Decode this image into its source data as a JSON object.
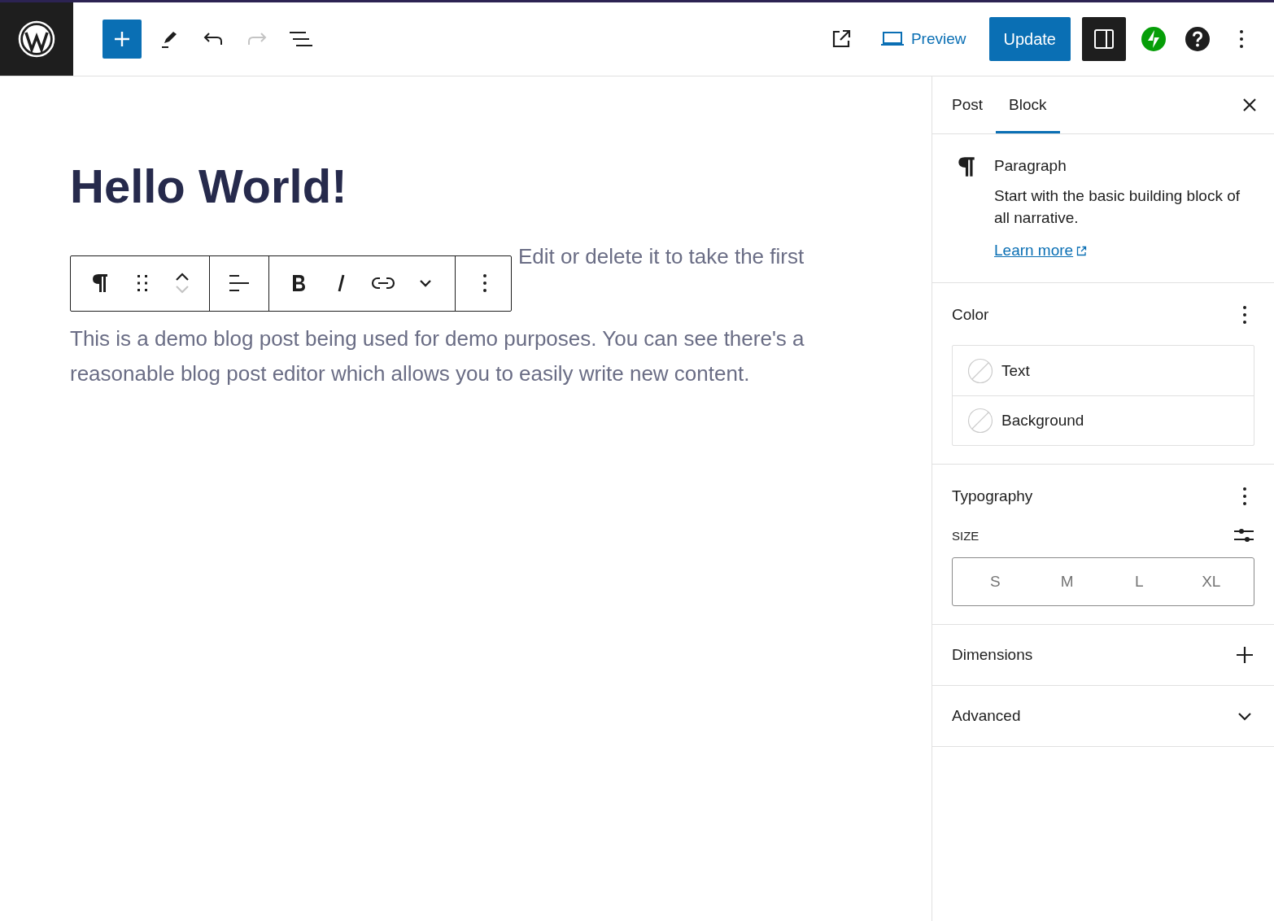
{
  "header": {
    "tools": [
      {
        "kind": "add",
        "disabled": false
      },
      {
        "kind": "edit",
        "disabled": false
      },
      {
        "kind": "undo",
        "disabled": false
      },
      {
        "kind": "redo",
        "disabled": true
      },
      {
        "kind": "outline",
        "disabled": false
      }
    ],
    "preview": "Preview",
    "update": "Update",
    "settings_on": true
  },
  "editor": {
    "title": "Hello World!",
    "paragraphs": [
      "Edit or delete it to take the first",
      "This is a demo blog post being used for demo purposes. You can see there's a reasonable blog post editor which allows you to easily write new content."
    ],
    "block_toolbar": {
      "move_up_disabled": false,
      "move_down_disabled": true
    }
  },
  "sidebar": {
    "tabs": [
      {
        "label": "Post",
        "selected": false
      },
      {
        "label": "Block",
        "selected": true
      }
    ],
    "block": {
      "name": "Paragraph",
      "description": "Start with the basic building block of all narrative.",
      "link": "Learn more"
    },
    "color": {
      "title": "Color",
      "items": [
        {
          "label": "Text"
        },
        {
          "label": "Background"
        }
      ]
    },
    "typography": {
      "title": "Typography",
      "size_label": "SIZE",
      "sizes": [
        {
          "label": "S",
          "selected": false
        },
        {
          "label": "M",
          "selected": false
        },
        {
          "label": "L",
          "selected": false
        },
        {
          "label": "XL",
          "selected": false
        }
      ]
    },
    "panels": [
      {
        "title": "Dimensions",
        "kind": "add"
      },
      {
        "title": "Advanced",
        "kind": "expand"
      }
    ]
  }
}
